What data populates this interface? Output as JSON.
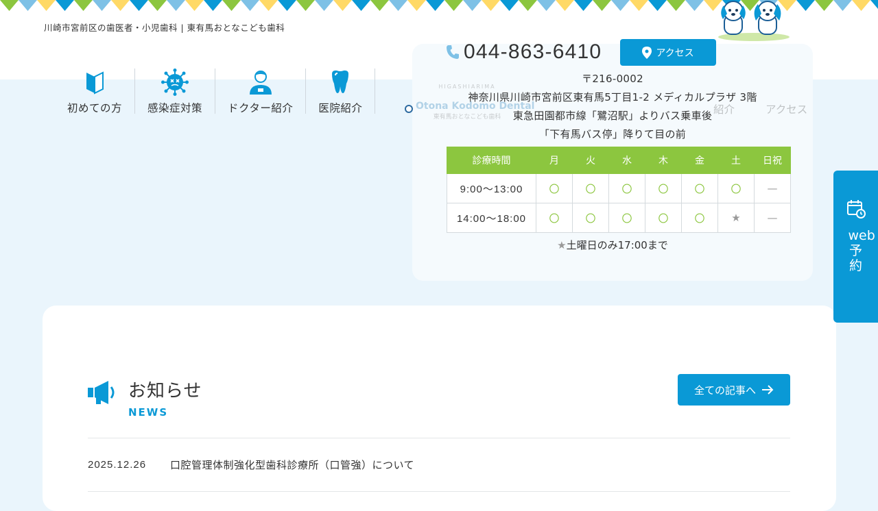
{
  "header": {
    "tagline": "川崎市宮前区の歯医者・小児歯科 | 東有馬おとなこども歯科",
    "phone": "044-863-6410",
    "access_label": "アクセス"
  },
  "nav": {
    "items": [
      {
        "label": "初めての方"
      },
      {
        "label": "感染症対策"
      },
      {
        "label": "ドクター紹介"
      },
      {
        "label": "医院紹介"
      }
    ],
    "ghost_items": [
      {
        "label": "紹介"
      },
      {
        "label": "アクセス"
      }
    ]
  },
  "ghost_logo": {
    "line1": "HIGASHIARIMA",
    "line2": "Otona Kodomo Dental",
    "line3": "東有馬おとなこども歯科"
  },
  "info": {
    "postal": "〒216-0002",
    "address": "神奈川県川崎市宮前区東有馬5丁目1-2 メディカルプラザ 3階",
    "route1": "東急田園都市線「鷺沼駅」よりバス乗車後",
    "route2": "「下有馬バス停」降りて目の前",
    "table": {
      "headers": [
        "診療時間",
        "月",
        "火",
        "水",
        "木",
        "金",
        "土",
        "日祝"
      ],
      "rows": [
        {
          "time": "9:00〜13:00",
          "marks": [
            "〇",
            "〇",
            "〇",
            "〇",
            "〇",
            "〇",
            "—"
          ]
        },
        {
          "time": "14:00〜18:00",
          "marks": [
            "〇",
            "〇",
            "〇",
            "〇",
            "〇",
            "★",
            "—"
          ]
        }
      ]
    },
    "note_star": "★",
    "note_text": "土曜日のみ17:00まで"
  },
  "booking": {
    "label": "web予約"
  },
  "news": {
    "title": "お知らせ",
    "subtitle": "NEWS",
    "all_label": "全ての記事へ",
    "items": [
      {
        "date": "2025.12.26",
        "text": "口腔管理体制強化型歯科診療所（口管強）について"
      }
    ]
  },
  "colors": {
    "accent": "#0a99d6",
    "green": "#8cc63f",
    "background": "#eaf5fc"
  },
  "icons": {
    "nav": [
      "beginner-mark-icon",
      "virus-icon",
      "doctor-icon",
      "tooth-icon"
    ],
    "phone": "phone-icon",
    "access": "map-pin-icon",
    "booking": "calendar-clock-icon",
    "news": "megaphone-icon",
    "arrow": "arrow-right-icon"
  }
}
